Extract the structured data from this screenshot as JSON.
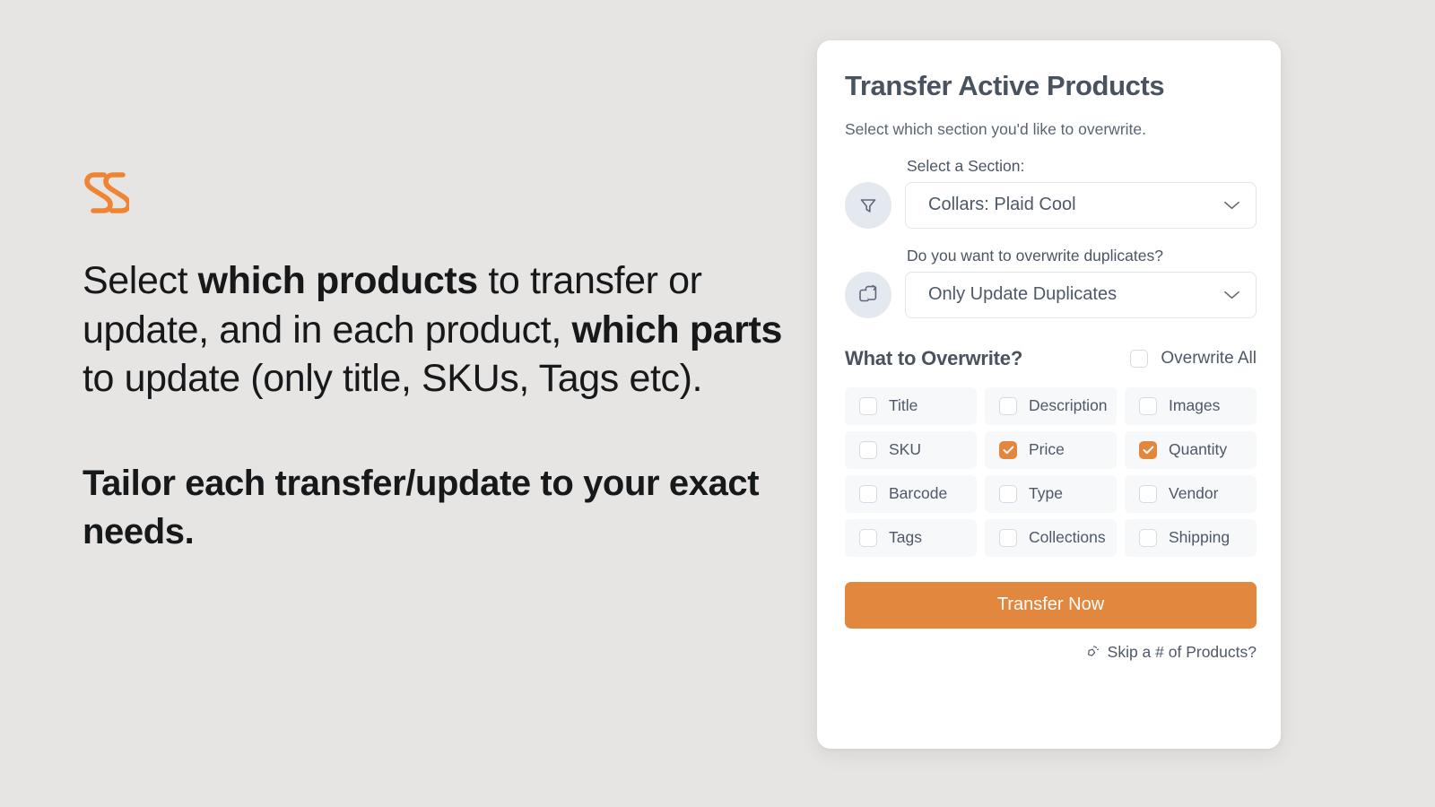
{
  "brand": {
    "logo_icon": "double-s-logo",
    "color": "#ef8434"
  },
  "marketing": {
    "headline_part1": "Select ",
    "headline_bold1": "which products",
    "headline_part2": " to transfer or update, and in each product, ",
    "headline_bold2": "which parts",
    "headline_part3": " to update (only title, SKUs, Tags etc).",
    "subline": "Tailor each transfer/update to your exact needs."
  },
  "card": {
    "title": "Transfer Active Products",
    "subtitle": "Select which section you'd like to overwrite.",
    "section_field": {
      "label": "Select a Section:",
      "icon": "funnel-filter-icon",
      "value": "Collars: Plaid Cool",
      "chevron": "chevron-down-icon"
    },
    "duplicates_field": {
      "label": "Do you want to overwrite duplicates?",
      "icon": "duplicate-copy-icon",
      "value": "Only Update Duplicates",
      "chevron": "chevron-down-icon"
    },
    "overwrite": {
      "heading": "What to Overwrite?",
      "all_label": "Overwrite All",
      "all_checked": false,
      "accent_color": "#e2883e",
      "options": [
        {
          "label": "Title",
          "checked": false
        },
        {
          "label": "Description",
          "checked": false
        },
        {
          "label": "Images",
          "checked": false
        },
        {
          "label": "SKU",
          "checked": false
        },
        {
          "label": "Price",
          "checked": true
        },
        {
          "label": "Quantity",
          "checked": true
        },
        {
          "label": "Barcode",
          "checked": false
        },
        {
          "label": "Type",
          "checked": false
        },
        {
          "label": "Vendor",
          "checked": false
        },
        {
          "label": "Tags",
          "checked": false
        },
        {
          "label": "Collections",
          "checked": false
        },
        {
          "label": "Shipping",
          "checked": false
        }
      ]
    },
    "cta_label": "Transfer Now",
    "skip_link": {
      "icon": "sparkle-star-icon",
      "label": "Skip a # of Products?"
    }
  }
}
